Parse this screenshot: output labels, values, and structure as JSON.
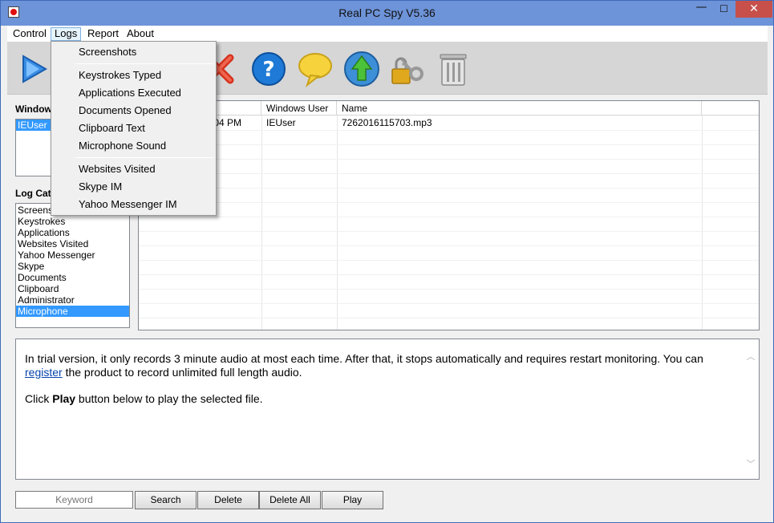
{
  "window": {
    "title": "Real PC Spy V5.36",
    "minimize": "—",
    "maximize": "☐",
    "close": "✕"
  },
  "menubar": {
    "items": [
      {
        "label": "Control"
      },
      {
        "label": "Logs"
      },
      {
        "label": "Report"
      },
      {
        "label": "About"
      }
    ]
  },
  "toolbar": {
    "icons": [
      "play-icon",
      "stop-icon",
      "help-icon",
      "speech-bubble-icon",
      "upload-icon",
      "lock-key-icon",
      "trash-icon"
    ]
  },
  "logs_menu": {
    "items": [
      {
        "label": "Screenshots"
      },
      {
        "label": "Keystrokes Typed"
      },
      {
        "label": "Applications Executed"
      },
      {
        "label": "Documents Opened"
      },
      {
        "label": "Clipboard Text"
      },
      {
        "label": "Microphone Sound"
      },
      {
        "label": "Websites Visited"
      },
      {
        "label": "Skype IM"
      },
      {
        "label": "Yahoo Messenger IM"
      }
    ]
  },
  "users_panel": {
    "label": "Window",
    "items": [
      {
        "label": "IEUser",
        "selected": true
      }
    ]
  },
  "log_categories": {
    "label": "Log Cate",
    "items": [
      {
        "label": "Screens",
        "selected": false
      },
      {
        "label": "Keystrokes",
        "selected": false
      },
      {
        "label": "Applications",
        "selected": false
      },
      {
        "label": "Websites Visited",
        "selected": false
      },
      {
        "label": "Yahoo Messenger",
        "selected": false
      },
      {
        "label": "Skype",
        "selected": false
      },
      {
        "label": "Documents",
        "selected": false
      },
      {
        "label": "Clipboard",
        "selected": false
      },
      {
        "label": "Administrator",
        "selected": false
      },
      {
        "label": "Microphone",
        "selected": true
      }
    ]
  },
  "grid": {
    "columns": [
      "",
      "Windows User",
      "Name",
      ""
    ],
    "rows": [
      {
        "time": ":04 PM",
        "user": "IEUser",
        "name": "7262016115703.mp3"
      }
    ]
  },
  "info": {
    "line1": "In trial version, it only records 3 minute audio at most each time. After that, it stops automatically and requires restart monitoring. You can",
    "link": "register",
    "line2_rest": " the product to record unlimited full length audio.",
    "play_prefix": "Click ",
    "play_bold": "Play",
    "play_suffix": " button below to play the selected file."
  },
  "bottom": {
    "keyword_placeholder": "Keyword",
    "search": "Search",
    "delete": "Delete",
    "delete_all": "Delete All",
    "play": "Play"
  },
  "colors": {
    "titlebar": "#6d93d8",
    "selection": "#3399ff",
    "close": "#c7504b"
  }
}
